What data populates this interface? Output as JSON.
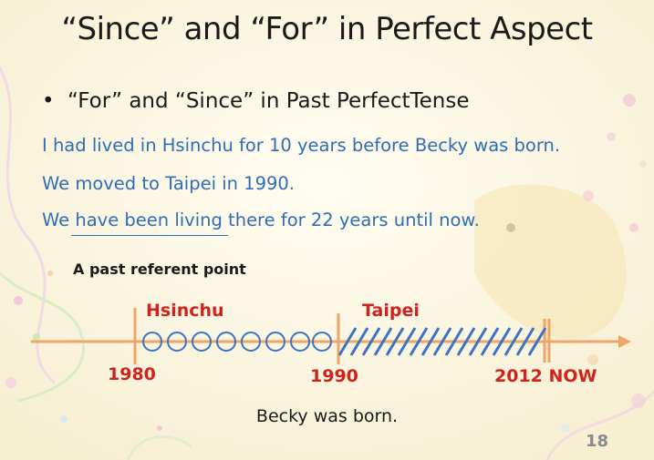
{
  "slide": {
    "title": "“Since” and “For” in Perfect Aspect",
    "bullet": "“For” and “Since” in Past PerfectTense",
    "lines": {
      "line1": "I had lived in Hsinchu for 10 years before Becky was born.",
      "line2": "We moved to Taipei in 1990.",
      "line3_pre": "We ",
      "line3_underlined": "have been living",
      "line3_post": " there for 22 years until now."
    },
    "subheading": "A past referent point",
    "timeline": {
      "place_1": "Hsinchu",
      "place_2": "Taipei",
      "year_start": "1980",
      "year_mid": "1990",
      "year_end": "2012 NOW",
      "caption": "Becky was born."
    },
    "page_number": "18"
  },
  "colors": {
    "background": "#fbf7e4",
    "text_blue": "#2f6db5",
    "accent_red": "#d1231d",
    "timeline_orange": "#f0a566"
  }
}
